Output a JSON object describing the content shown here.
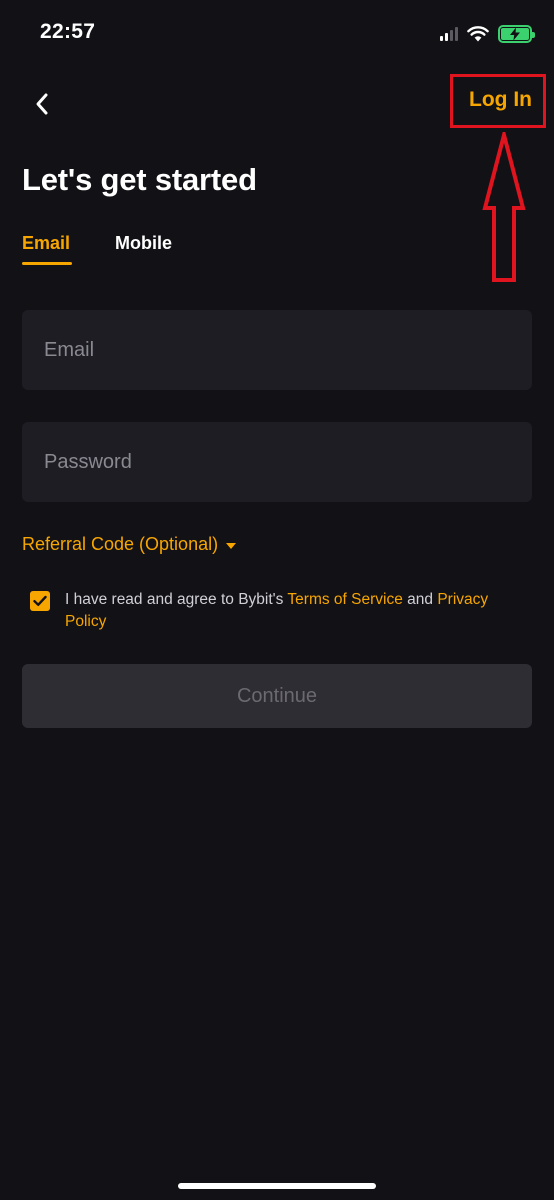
{
  "status_bar": {
    "time": "22:57",
    "icons": [
      "cellular-signal-icon",
      "wifi-icon",
      "battery-charging-icon"
    ]
  },
  "nav": {
    "back_icon": "chevron-left-icon",
    "login_label": "Log In"
  },
  "page": {
    "title": "Let's get started"
  },
  "tabs": [
    {
      "label": "Email",
      "active": true
    },
    {
      "label": "Mobile",
      "active": false
    }
  ],
  "form": {
    "email_placeholder": "Email",
    "email_value": "",
    "password_placeholder": "Password",
    "password_value": "",
    "referral_label": "Referral Code (Optional)",
    "agreement": {
      "checked": true,
      "prefix": "I have read and agree to Bybit's ",
      "terms_link": "Terms of Service",
      "conjunction": " and ",
      "privacy_link": "Privacy Policy"
    },
    "continue_label": "Continue"
  },
  "colors": {
    "background": "#121116",
    "accent": "#f7a600",
    "field_bg": "#1e1d24",
    "button_disabled_bg": "#2e2d33",
    "annotation_red": "#e0141e",
    "battery_green": "#3bd16f"
  }
}
